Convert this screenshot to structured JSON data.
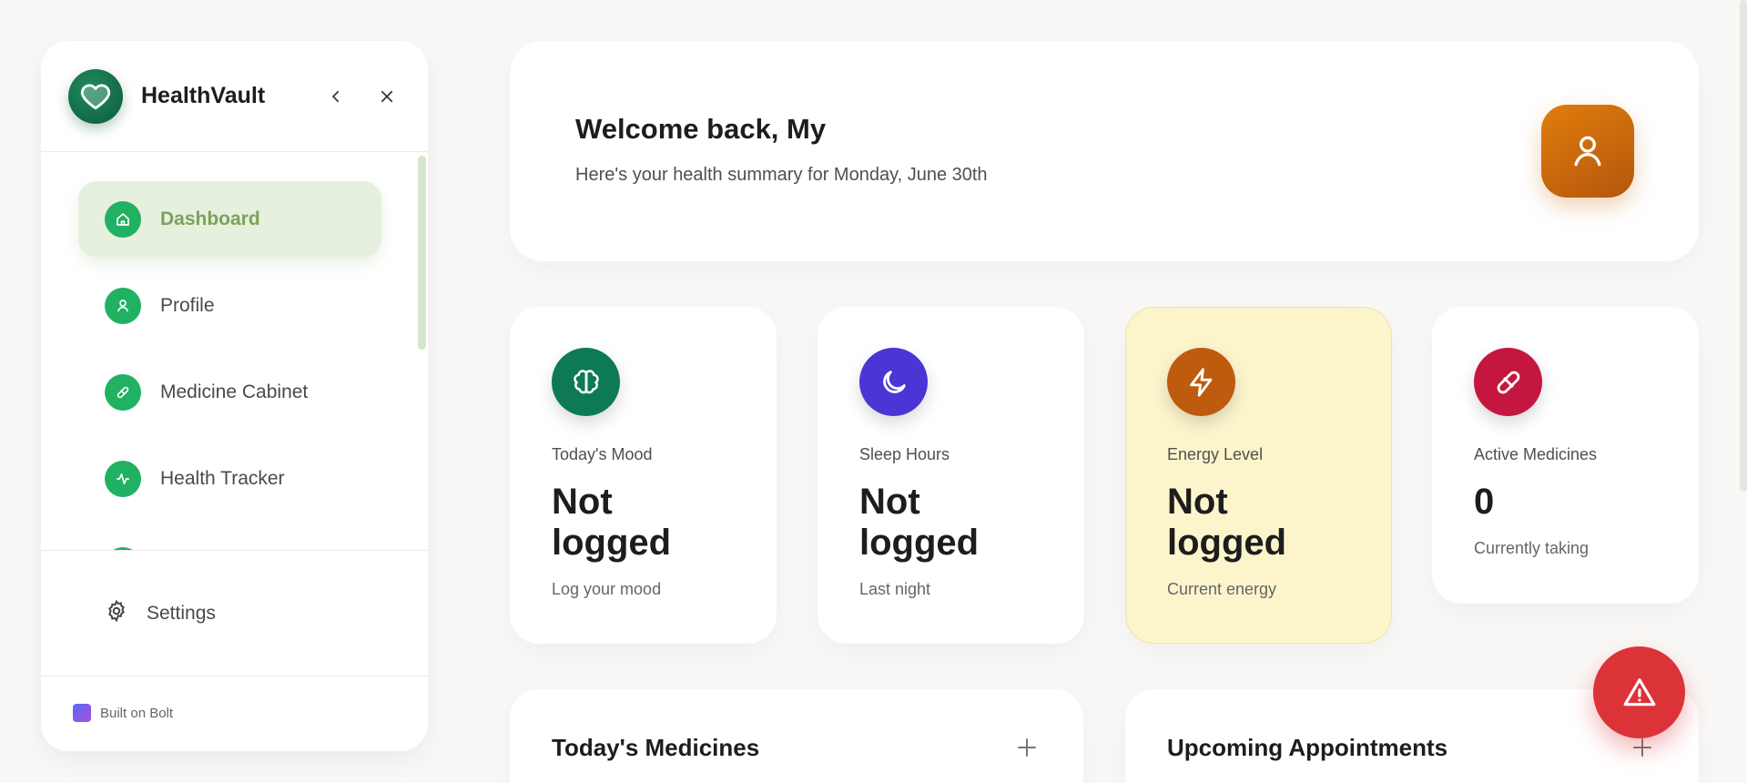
{
  "sidebar": {
    "brand": "HealthVault",
    "items": [
      {
        "label": "Dashboard",
        "icon": "home-icon",
        "active": true
      },
      {
        "label": "Profile",
        "icon": "user-icon"
      },
      {
        "label": "Medicine Cabinet",
        "icon": "pill-icon"
      },
      {
        "label": "Health Tracker",
        "icon": "activity-icon"
      }
    ],
    "settings_label": "Settings",
    "built_label": "Built on Bolt"
  },
  "welcome": {
    "title": "Welcome back, My",
    "subtitle": "Here's your health summary for Monday, June 30th"
  },
  "stats": [
    {
      "label": "Today's Mood",
      "value": "Not logged",
      "sub": "Log your mood",
      "icon": "brain-icon",
      "color": "#0e7a55"
    },
    {
      "label": "Sleep Hours",
      "value": "Not logged",
      "sub": "Last night",
      "icon": "moon-icon",
      "color": "#4a36d4"
    },
    {
      "label": "Energy Level",
      "value": "Not logged",
      "sub": "Current energy",
      "icon": "bolt-icon",
      "color": "#bf5b0e"
    },
    {
      "label": "Active Medicines",
      "value": "0",
      "sub": "Currently taking",
      "icon": "pill-icon",
      "color": "#c5163f"
    }
  ],
  "panels": {
    "medicines_title": "Today's Medicines",
    "appointments_title": "Upcoming Appointments"
  },
  "colors": {
    "accent_green": "#20b163",
    "active_bg": "#e6f0de",
    "sos": "#dc3338"
  }
}
